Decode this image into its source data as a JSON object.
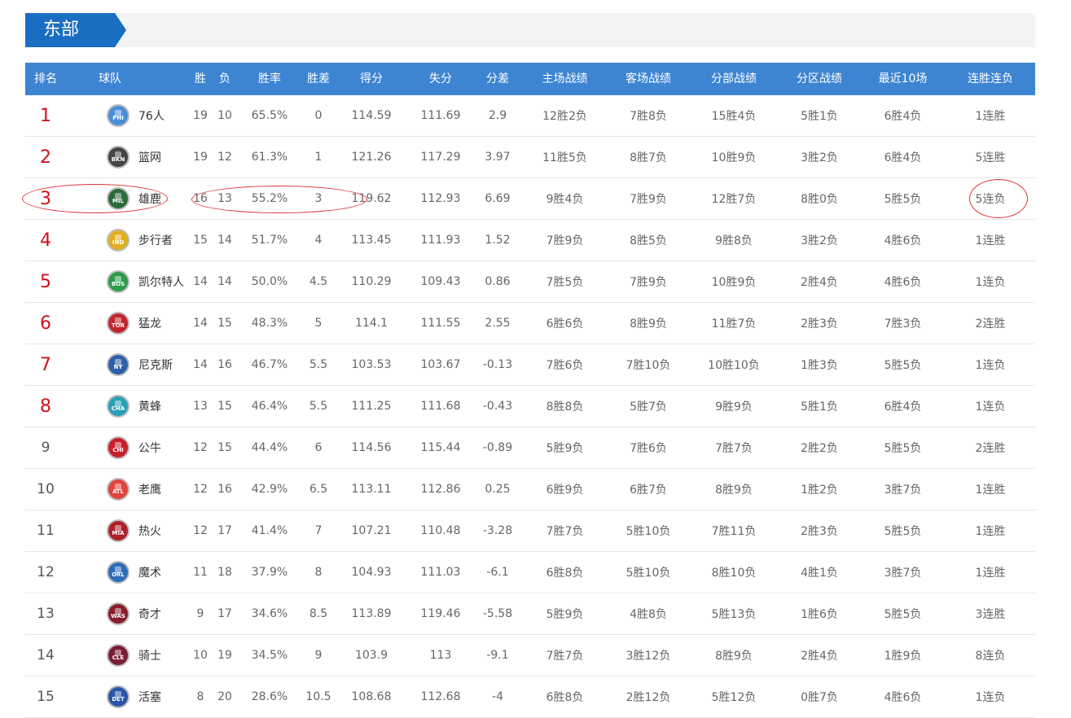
{
  "conference": {
    "label": "东部"
  },
  "columns": [
    "排名",
    "球队",
    "胜",
    "负",
    "胜率",
    "胜差",
    "得分",
    "失分",
    "分差",
    "主场战绩",
    "客场战绩",
    "分部战绩",
    "分区战绩",
    "最近10场",
    "连胜连负"
  ],
  "teams": [
    {
      "rank": "1",
      "name": "76人",
      "abbr": "PHI",
      "color": "#4a8fd6",
      "w": "19",
      "l": "10",
      "pct": "65.5%",
      "gb": "0",
      "pf": "114.59",
      "pa": "111.69",
      "diff": "2.9",
      "home": "12胜2负",
      "away": "7胜8负",
      "div": "15胜4负",
      "conf": "5胜1负",
      "last10": "6胜4负",
      "streak": "1连胜"
    },
    {
      "rank": "2",
      "name": "篮网",
      "abbr": "BKN",
      "color": "#444444",
      "w": "19",
      "l": "12",
      "pct": "61.3%",
      "gb": "1",
      "pf": "121.26",
      "pa": "117.29",
      "diff": "3.97",
      "home": "11胜5负",
      "away": "8胜7负",
      "div": "10胜9负",
      "conf": "3胜2负",
      "last10": "6胜4负",
      "streak": "5连胜"
    },
    {
      "rank": "3",
      "name": "雄鹿",
      "abbr": "MIL",
      "color": "#2e6b3a",
      "w": "16",
      "l": "13",
      "pct": "55.2%",
      "gb": "3",
      "pf": "119.62",
      "pa": "112.93",
      "diff": "6.69",
      "home": "9胜4负",
      "away": "7胜9负",
      "div": "12胜7负",
      "conf": "8胜0负",
      "last10": "5胜5负",
      "streak": "5连负"
    },
    {
      "rank": "4",
      "name": "步行者",
      "abbr": "IND",
      "color": "#e0b020",
      "w": "15",
      "l": "14",
      "pct": "51.7%",
      "gb": "4",
      "pf": "113.45",
      "pa": "111.93",
      "diff": "1.52",
      "home": "7胜9负",
      "away": "8胜5负",
      "div": "9胜8负",
      "conf": "3胜2负",
      "last10": "4胜6负",
      "streak": "1连胜"
    },
    {
      "rank": "5",
      "name": "凯尔特人",
      "abbr": "BOS",
      "color": "#2e9a4a",
      "w": "14",
      "l": "14",
      "pct": "50.0%",
      "gb": "4.5",
      "pf": "110.29",
      "pa": "109.43",
      "diff": "0.86",
      "home": "7胜5负",
      "away": "7胜9负",
      "div": "10胜9负",
      "conf": "2胜4负",
      "last10": "4胜6负",
      "streak": "1连负"
    },
    {
      "rank": "6",
      "name": "猛龙",
      "abbr": "TOR",
      "color": "#c2262e",
      "w": "14",
      "l": "15",
      "pct": "48.3%",
      "gb": "5",
      "pf": "114.1",
      "pa": "111.55",
      "diff": "2.55",
      "home": "6胜6负",
      "away": "8胜9负",
      "div": "11胜7负",
      "conf": "2胜3负",
      "last10": "7胜3负",
      "streak": "2连胜"
    },
    {
      "rank": "7",
      "name": "尼克斯",
      "abbr": "NY",
      "color": "#2f5fa8",
      "w": "14",
      "l": "16",
      "pct": "46.7%",
      "gb": "5.5",
      "pf": "103.53",
      "pa": "103.67",
      "diff": "-0.13",
      "home": "7胜6负",
      "away": "7胜10负",
      "div": "10胜10负",
      "conf": "1胜3负",
      "last10": "5胜5负",
      "streak": "1连负"
    },
    {
      "rank": "8",
      "name": "黄蜂",
      "abbr": "CHA",
      "color": "#2aa0b8",
      "w": "13",
      "l": "15",
      "pct": "46.4%",
      "gb": "5.5",
      "pf": "111.25",
      "pa": "111.68",
      "diff": "-0.43",
      "home": "8胜8负",
      "away": "5胜7负",
      "div": "9胜9负",
      "conf": "5胜1负",
      "last10": "6胜4负",
      "streak": "1连负"
    },
    {
      "rank": "9",
      "name": "公牛",
      "abbr": "CHI",
      "color": "#c8202a",
      "w": "12",
      "l": "15",
      "pct": "44.4%",
      "gb": "6",
      "pf": "114.56",
      "pa": "115.44",
      "diff": "-0.89",
      "home": "5胜9负",
      "away": "7胜6负",
      "div": "7胜7负",
      "conf": "2胜2负",
      "last10": "5胜5负",
      "streak": "2连胜"
    },
    {
      "rank": "10",
      "name": "老鹰",
      "abbr": "ATL",
      "color": "#e0443a",
      "w": "12",
      "l": "16",
      "pct": "42.9%",
      "gb": "6.5",
      "pf": "113.11",
      "pa": "112.86",
      "diff": "0.25",
      "home": "6胜9负",
      "away": "6胜7负",
      "div": "8胜9负",
      "conf": "1胜2负",
      "last10": "3胜7负",
      "streak": "1连胜"
    },
    {
      "rank": "11",
      "name": "热火",
      "abbr": "MIA",
      "color": "#b0202a",
      "w": "12",
      "l": "17",
      "pct": "41.4%",
      "gb": "7",
      "pf": "107.21",
      "pa": "110.48",
      "diff": "-3.28",
      "home": "7胜7负",
      "away": "5胜10负",
      "div": "7胜11负",
      "conf": "2胜3负",
      "last10": "5胜5负",
      "streak": "1连胜"
    },
    {
      "rank": "12",
      "name": "魔术",
      "abbr": "ORL",
      "color": "#2f6cb8",
      "w": "11",
      "l": "18",
      "pct": "37.9%",
      "gb": "8",
      "pf": "104.93",
      "pa": "111.03",
      "diff": "-6.1",
      "home": "6胜8负",
      "away": "5胜10负",
      "div": "8胜10负",
      "conf": "4胜1负",
      "last10": "3胜7负",
      "streak": "1连胜"
    },
    {
      "rank": "13",
      "name": "奇才",
      "abbr": "WAS",
      "color": "#8a1c2c",
      "w": "9",
      "l": "17",
      "pct": "34.6%",
      "gb": "8.5",
      "pf": "113.89",
      "pa": "119.46",
      "diff": "-5.58",
      "home": "5胜9负",
      "away": "4胜8负",
      "div": "5胜13负",
      "conf": "1胜6负",
      "last10": "5胜5负",
      "streak": "3连胜"
    },
    {
      "rank": "14",
      "name": "骑士",
      "abbr": "CLE",
      "color": "#7a1e34",
      "w": "10",
      "l": "19",
      "pct": "34.5%",
      "gb": "9",
      "pf": "103.9",
      "pa": "113",
      "diff": "-9.1",
      "home": "7胜7负",
      "away": "3胜12负",
      "div": "8胜9负",
      "conf": "2胜4负",
      "last10": "1胜9负",
      "streak": "8连负"
    },
    {
      "rank": "15",
      "name": "活塞",
      "abbr": "DET",
      "color": "#2a55a8",
      "w": "8",
      "l": "20",
      "pct": "28.6%",
      "gb": "10.5",
      "pf": "108.68",
      "pa": "112.68",
      "diff": "-4",
      "home": "6胜8负",
      "away": "2胜12负",
      "div": "5胜12负",
      "conf": "0胜7负",
      "last10": "4胜6负",
      "streak": "1连负"
    }
  ],
  "colors": {
    "header_bg": "#3d85d3",
    "tab_bg": "#1a6ec2",
    "top_rank": "#d0101b",
    "annotation": "#e1343a"
  }
}
